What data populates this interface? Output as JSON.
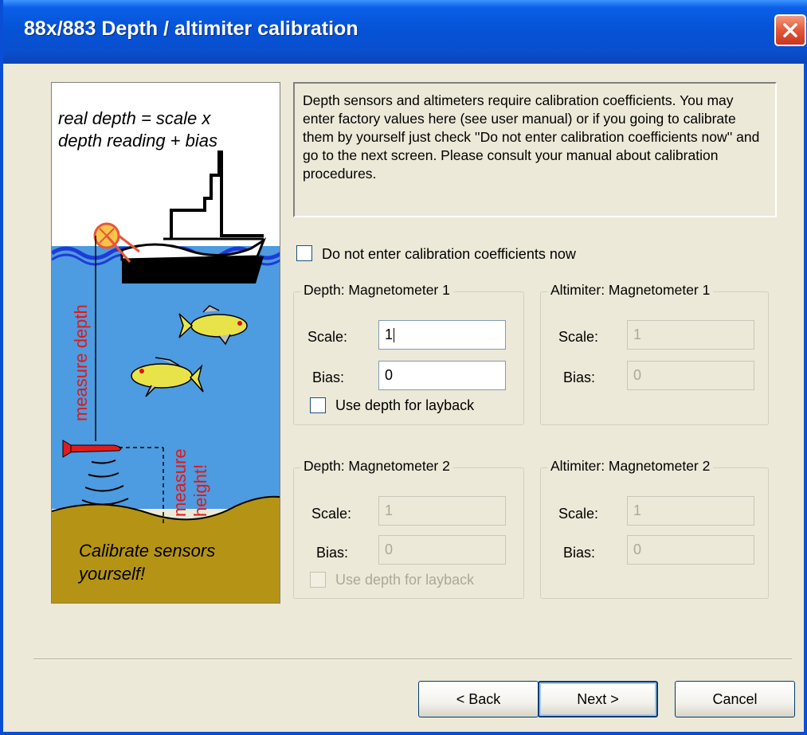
{
  "window": {
    "title": "88x/883 Depth / altimiter calibration"
  },
  "picture": {
    "formula_line1": "real depth = scale x",
    "formula_line2": "depth reading + bias",
    "measure_depth": "measure depth",
    "measure_height_line1": "measure",
    "measure_height_line2": "height!",
    "calibrate_line1": "Calibrate sensors",
    "calibrate_line2": "yourself!"
  },
  "description": "Depth sensors and altimeters require calibration coefficients. You may enter factory values here (see user manual) or if you going to calibrate them by yourself just check ''Do not enter calibration coefficients now'' and go to the next screen. Please consult your manual about calibration procedures.",
  "skip_checkbox": {
    "label": "Do not enter calibration coefficients now",
    "checked": false
  },
  "groups": {
    "depth1": {
      "title": "Depth: Magnetometer 1",
      "scale_label": "Scale:",
      "scale_value": "1",
      "bias_label": "Bias:",
      "bias_value": "0",
      "layback_label": "Use depth for layback",
      "enabled": true
    },
    "alt1": {
      "title": "Altimiter: Magnetometer 1",
      "scale_label": "Scale:",
      "scale_value": "1",
      "bias_label": "Bias:",
      "bias_value": "0",
      "enabled": false
    },
    "depth2": {
      "title": "Depth: Magnetometer 2",
      "scale_label": "Scale:",
      "scale_value": "1",
      "bias_label": "Bias:",
      "bias_value": "0",
      "layback_label": "Use depth for layback",
      "enabled": false
    },
    "alt2": {
      "title": "Altimiter: Magnetometer 2",
      "scale_label": "Scale:",
      "scale_value": "1",
      "bias_label": "Bias:",
      "bias_value": "0",
      "enabled": false
    }
  },
  "buttons": {
    "back": "< Back",
    "next": "Next >",
    "cancel": "Cancel"
  },
  "colors": {
    "titlebar": "#0553d6",
    "close_button": "#e2573a",
    "sky": "#ffffff",
    "water": "#4d9be0",
    "seabed": "#b59415",
    "fish": "#e9e34a",
    "towfish": "#e11b1b",
    "label_red": "#e01818"
  },
  "icons": {
    "close": "close-x-icon",
    "picture": "boat-fish-towfish-illustration"
  }
}
